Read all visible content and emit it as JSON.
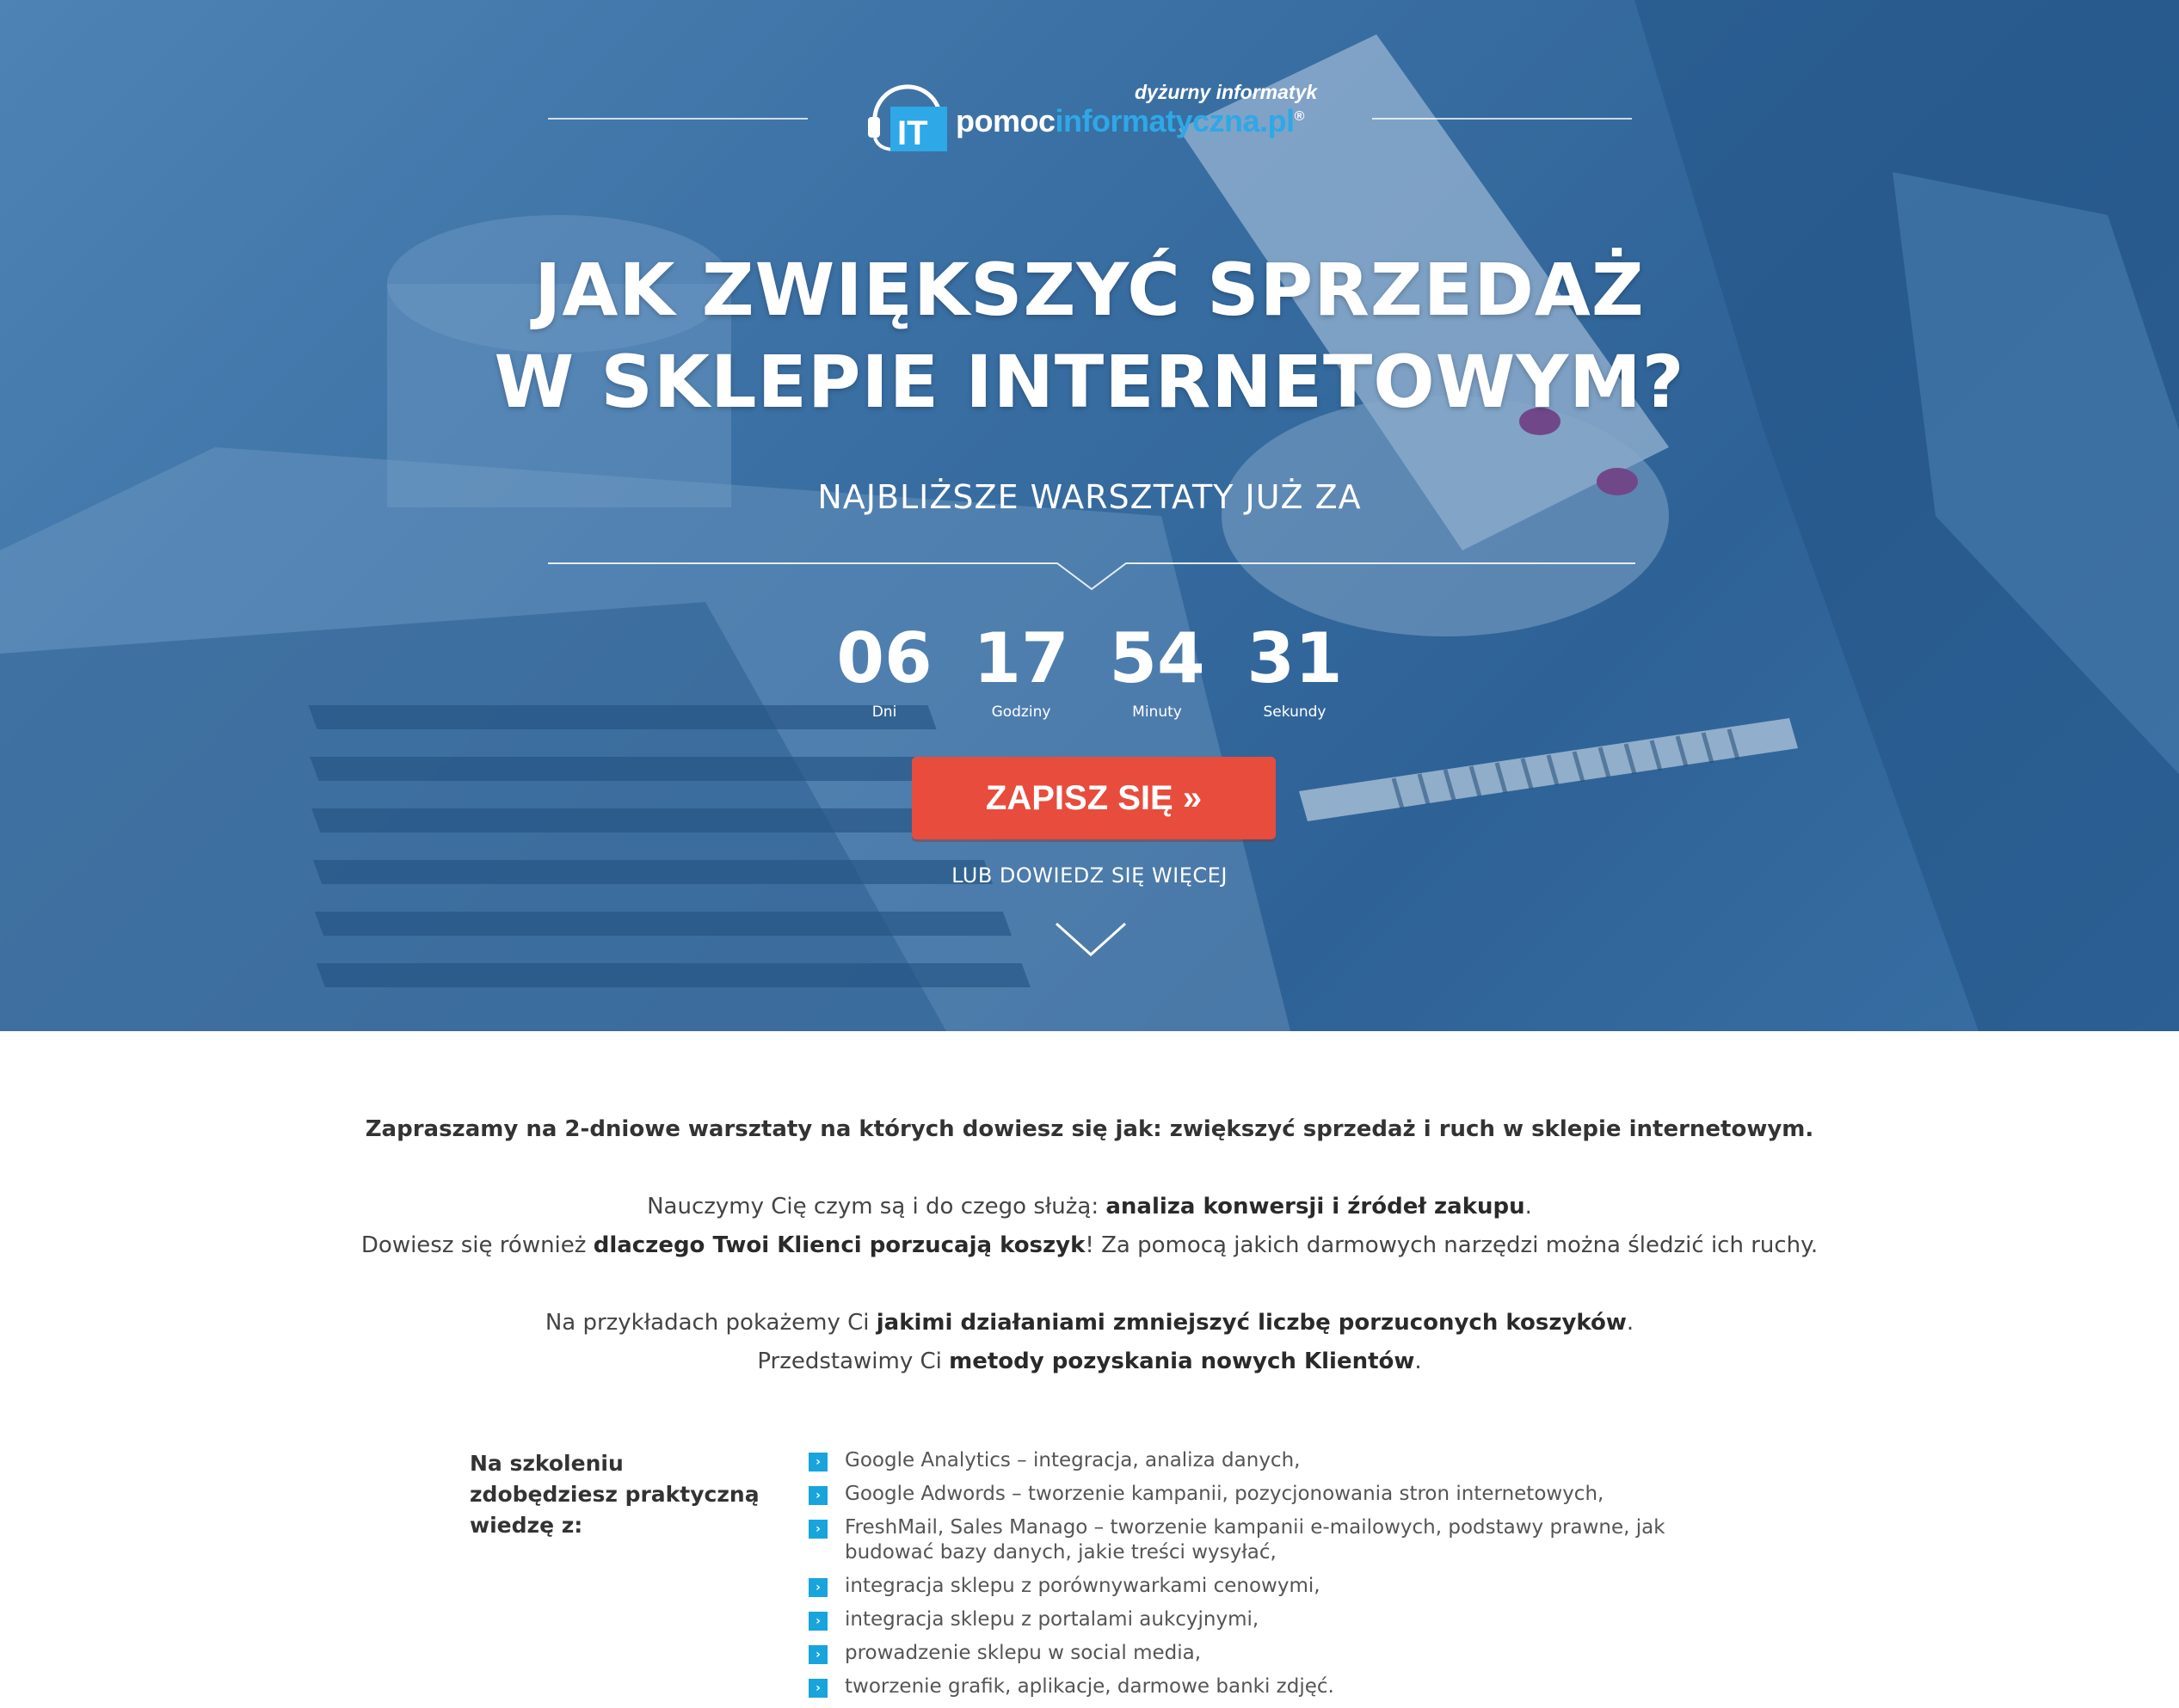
{
  "colors": {
    "hero_blue": "#3e73a6",
    "cta_red": "#e84c3d",
    "bullet_blue": "#18a4dc",
    "logo_accent": "#2ea8e6"
  },
  "logo": {
    "tagline": "dyżurny informatyk",
    "name_white": "pomoc",
    "name_blue": "informatyczna.pl",
    "trademark": "®",
    "icon": "headset-it-icon"
  },
  "hero": {
    "title_line1": "JAK ZWIĘKSZYĆ SPRZEDAŻ",
    "title_line2": "W SKLEPIE INTERNETOWYM?",
    "subtitle": "NAJBLIŻSZE WARSZTATY JUŻ ZA"
  },
  "countdown": {
    "days": {
      "value": "06",
      "label": "Dni"
    },
    "hours": {
      "value": "17",
      "label": "Godziny"
    },
    "minutes": {
      "value": "54",
      "label": "Minuty"
    },
    "seconds": {
      "value": "31",
      "label": "Sekundy"
    }
  },
  "cta": {
    "label": "ZAPISZ SIĘ »",
    "more_link": "LUB DOWIEDZ SIĘ WIĘCEJ"
  },
  "content": {
    "intro": "Zapraszamy na 2-dniowe warsztaty na których dowiesz się jak: zwiększyć sprzedaż i ruch w sklepie internetowym.",
    "p1": {
      "before": "Nauczymy Cię czym są i do czego służą: ",
      "bold": "analiza konwersji i źródeł zakupu",
      "after": "."
    },
    "p2": {
      "before": "Dowiesz się również ",
      "bold": "dlaczego Twoi Klienci porzucają koszyk",
      "after": "! Za pomocą jakich darmowych narzędzi można śledzić ich ruchy."
    },
    "p3": {
      "before": "Na przykładach pokażemy Ci ",
      "bold": "jakimi działaniami zmniejszyć liczbę porzuconych koszyków",
      "after": "."
    },
    "p4": {
      "before": "Przedstawimy Ci ",
      "bold": "metody pozyskania nowych Klientów",
      "after": "."
    }
  },
  "skills": {
    "heading": "Na szkoleniu zdobędziesz praktyczną wiedzę z:",
    "bullet_glyph": "›",
    "items": [
      "Google Analytics – integracja, analiza danych,",
      "Google Adwords – tworzenie kampanii, pozycjonowania stron internetowych,",
      "FreshMail, Sales Manago – tworzenie kampanii e-mailowych, podstawy prawne, jak budować bazy danych, jakie treści wysyłać,",
      "integracja sklepu z porównywarkami cenowymi,",
      "integracja sklepu z portalami aukcyjnymi,",
      "prowadzenie sklepu w social media,",
      "tworzenie grafik, aplikacje, darmowe banki zdjęć."
    ]
  }
}
